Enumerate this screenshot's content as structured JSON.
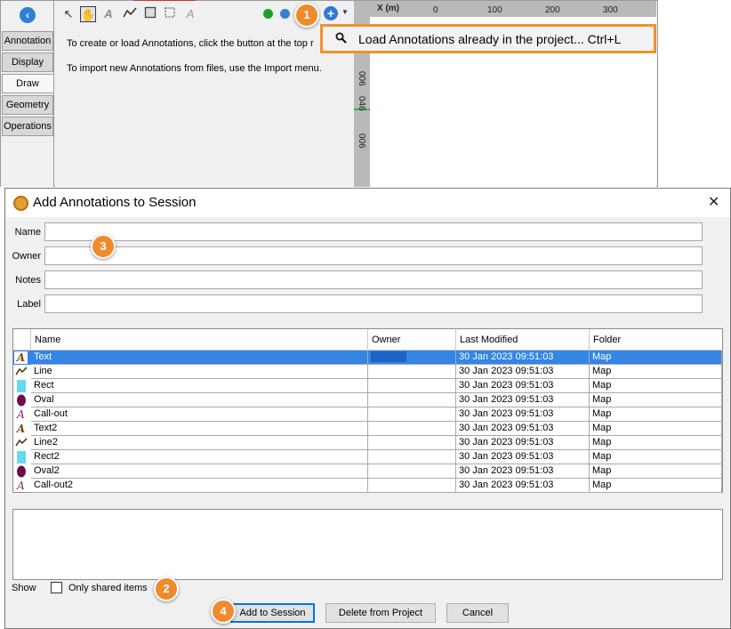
{
  "app": {
    "tabs": [
      "Annotation",
      "Display",
      "Draw",
      "Geometry",
      "Operations"
    ],
    "active_tab": "Draw",
    "info_line1": "To create or load Annotations, click the button at the top r",
    "info_line2": "To import new Annotations from files, use the Import menu.",
    "ruler": {
      "x_label": "X (m)",
      "x_ticks": [
        "0",
        "100",
        "200",
        "300"
      ],
      "y_ticks": [
        "006",
        "046",
        "006"
      ]
    },
    "menu": {
      "item_label": "Load Annotations already in the project... Ctrl+L",
      "item_icon": "search-icon"
    }
  },
  "callouts": [
    "1",
    "2",
    "3",
    "4"
  ],
  "dialog": {
    "title": "Add Annotations to Session",
    "close_glyph": "✕",
    "fields": {
      "name_label": "Name",
      "name_value": "",
      "owner_label": "Owner",
      "owner_value": "",
      "notes_label": "Notes",
      "notes_value": "",
      "label_label": "Label",
      "label_value": ""
    },
    "table": {
      "columns": [
        "Name",
        "Owner",
        "Last Modified",
        "Folder"
      ],
      "rows": [
        {
          "icon": "text-icon",
          "name": "Text",
          "owner": "",
          "modified": "30 Jan 2023 09:51:03",
          "folder": "Map"
        },
        {
          "icon": "line-icon",
          "name": "Line",
          "owner": "",
          "modified": "30 Jan 2023 09:51:03",
          "folder": "Map"
        },
        {
          "icon": "rect-icon",
          "name": "Rect",
          "owner": "",
          "modified": "30 Jan 2023 09:51:03",
          "folder": "Map"
        },
        {
          "icon": "oval-icon",
          "name": "Oval",
          "owner": "",
          "modified": "30 Jan 2023 09:51:03",
          "folder": "Map"
        },
        {
          "icon": "callout-icon",
          "name": "Call-out",
          "owner": "",
          "modified": "30 Jan 2023 09:51:03",
          "folder": "Map"
        },
        {
          "icon": "text-icon",
          "name": "Text2",
          "owner": "",
          "modified": "30 Jan 2023 09:51:03",
          "folder": "Map"
        },
        {
          "icon": "line-icon",
          "name": "Line2",
          "owner": "",
          "modified": "30 Jan 2023 09:51:03",
          "folder": "Map"
        },
        {
          "icon": "rect-icon",
          "name": "Rect2",
          "owner": "",
          "modified": "30 Jan 2023 09:51:03",
          "folder": "Map"
        },
        {
          "icon": "oval-icon",
          "name": "Oval2",
          "owner": "",
          "modified": "30 Jan 2023 09:51:03",
          "folder": "Map"
        },
        {
          "icon": "callout-icon",
          "name": "Call-out2",
          "owner": "",
          "modified": "30 Jan 2023 09:51:03",
          "folder": "Map"
        }
      ],
      "selected_row": 0
    },
    "show_label": "Show",
    "only_shared_label": "Only shared items",
    "only_shared_checked": false,
    "buttons": {
      "add": "Add to Session",
      "delete": "Delete from Project",
      "cancel": "Cancel"
    }
  },
  "colors": {
    "selection": "#3385e6",
    "accent_orange": "#ef8b2c",
    "text_icon": "#6b4a1a",
    "line_icon": "#5a3b1a",
    "rect_icon": "#66d9ef",
    "oval_icon": "#6b0f4b",
    "callout_icon": "#8e2a6e"
  }
}
